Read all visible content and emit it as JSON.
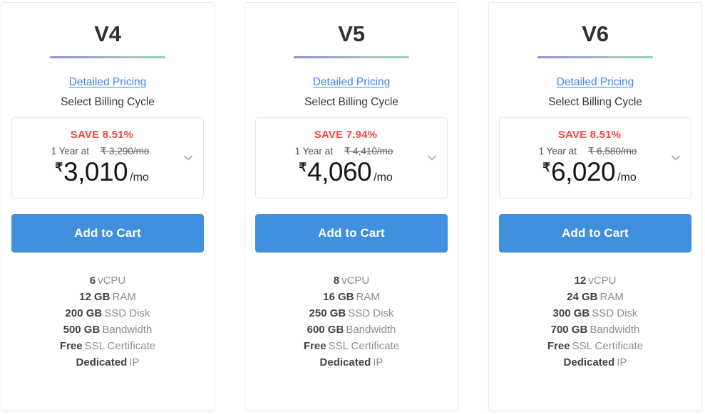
{
  "colors": {
    "cta_bg": "#4190e0",
    "save_red": "#f9443c",
    "link_blue": "#4285f4",
    "rule_start": "#8f93c6",
    "rule_end": "#8ed3ad",
    "card_border": "#e7ecf2"
  },
  "labels": {
    "detailed_pricing": "Detailed Pricing",
    "select_billing_cycle": "Select Billing Cycle",
    "add_to_cart": "Add to Cart",
    "chevron_icon": "chevron-down-icon"
  },
  "plans": [
    {
      "title": "V4",
      "save_text": "SAVE 8.51%",
      "term": "1 Year at",
      "old_price": "₹ 3,290/mo",
      "currency": "₹",
      "price": "3,010",
      "per": "/mo",
      "features": [
        {
          "value": "6",
          "label": "vCPU"
        },
        {
          "value": "12 GB",
          "label": "RAM"
        },
        {
          "value": "200 GB",
          "label": "SSD Disk"
        },
        {
          "value": "500 GB",
          "label": "Bandwidth"
        },
        {
          "value": "Free",
          "label": "SSL Certificate"
        },
        {
          "value": "Dedicated",
          "label": "IP"
        }
      ]
    },
    {
      "title": "V5",
      "save_text": "SAVE 7.94%",
      "term": "1 Year at",
      "old_price": "₹ 4,410/mo",
      "currency": "₹",
      "price": "4,060",
      "per": "/mo",
      "features": [
        {
          "value": "8",
          "label": "vCPU"
        },
        {
          "value": "16 GB",
          "label": "RAM"
        },
        {
          "value": "250 GB",
          "label": "SSD Disk"
        },
        {
          "value": "600 GB",
          "label": "Bandwidth"
        },
        {
          "value": "Free",
          "label": "SSL Certificate"
        },
        {
          "value": "Dedicated",
          "label": "IP"
        }
      ]
    },
    {
      "title": "V6",
      "save_text": "SAVE 8.51%",
      "term": "1 Year at",
      "old_price": "₹ 6,580/mo",
      "currency": "₹",
      "price": "6,020",
      "per": "/mo",
      "features": [
        {
          "value": "12",
          "label": "vCPU"
        },
        {
          "value": "24 GB",
          "label": "RAM"
        },
        {
          "value": "300 GB",
          "label": "SSD Disk"
        },
        {
          "value": "700 GB",
          "label": "Bandwidth"
        },
        {
          "value": "Free",
          "label": "SSL Certificate"
        },
        {
          "value": "Dedicated",
          "label": "IP"
        }
      ]
    }
  ]
}
